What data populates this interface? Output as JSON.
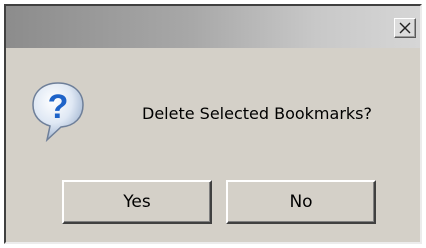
{
  "dialog": {
    "message": "Delete Selected Bookmarks?",
    "icon": "question-icon",
    "buttons": {
      "yes_label": "Yes",
      "no_label": "No"
    },
    "close_icon": "close-icon"
  },
  "colors": {
    "dialog_background": "#d4d0c8",
    "icon_blue": "#1e63c8",
    "title_gradient_start": "#8c8c8c",
    "title_gradient_end": "#d6d6d6"
  }
}
